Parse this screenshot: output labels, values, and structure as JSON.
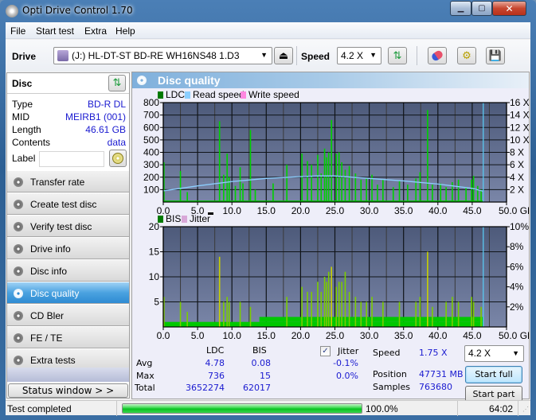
{
  "window": {
    "title": "Opti Drive Control 1.70",
    "controls": [
      "minimize",
      "maximize",
      "close"
    ]
  },
  "menu": [
    "File",
    "Start test",
    "Extra",
    "Help"
  ],
  "toolbar": {
    "drive_label": "Drive",
    "drive_value": "(J:)  HL-DT-ST BD-RE  WH16NS48 1.D3",
    "speed_label": "Speed",
    "speed_value": "4.2 X",
    "icons": [
      "eject-icon",
      "refresh-icon",
      "erase-icon",
      "settings-icon",
      "save-icon"
    ]
  },
  "disc": {
    "header": "Disc",
    "rows": [
      {
        "key": "Type",
        "value": "BD-R DL"
      },
      {
        "key": "MID",
        "value": "MEIRB1 (001)"
      },
      {
        "key": "Length",
        "value": "46.61 GB"
      },
      {
        "key": "Contents",
        "value": "data"
      }
    ],
    "label_key": "Label",
    "label_value": ""
  },
  "nav": [
    {
      "label": "Transfer rate",
      "active": false
    },
    {
      "label": "Create test disc",
      "active": false
    },
    {
      "label": "Verify test disc",
      "active": false
    },
    {
      "label": "Drive info",
      "active": false
    },
    {
      "label": "Disc info",
      "active": false
    },
    {
      "label": "Disc quality",
      "active": true
    },
    {
      "label": "CD Bler",
      "active": false
    },
    {
      "label": "FE / TE",
      "active": false
    },
    {
      "label": "Extra tests",
      "active": false
    }
  ],
  "status_window_button": "Status window > >",
  "panel_title": "Disc quality",
  "colors": {
    "ldc": "#00c000",
    "bis": "#00c000",
    "read_speed": "#8ccfff",
    "write_speed": "#ff88e0",
    "jitter": "#d8a8d8",
    "plot_bg_top": "#4d5a7a",
    "plot_bg_bottom": "#7a86a8",
    "accent": "#2f8bd3"
  },
  "chart_data": [
    {
      "type": "bar",
      "title": "LDC / Read speed",
      "legend": [
        "LDC",
        "Read speed",
        "Write speed"
      ],
      "legend_position": "top-left",
      "xlabel": "GB",
      "x_ticks": [
        "0.0",
        "5.0",
        "10.0",
        "15.0",
        "20.0",
        "25.0",
        "30.0",
        "35.0",
        "40.0",
        "45.0",
        "50.0 GB"
      ],
      "xlim": [
        0,
        50
      ],
      "y_ticks_left": [
        "100",
        "200",
        "300",
        "400",
        "500",
        "600",
        "700",
        "800"
      ],
      "ylim_left": [
        0,
        800
      ],
      "y_ticks_right": [
        "2 X",
        "4 X",
        "6 X",
        "8 X",
        "10 X",
        "12 X",
        "14 X",
        "16 X"
      ],
      "ylim_right": [
        0,
        16
      ],
      "grid": true,
      "end_marker_gb": 46.61,
      "ldc_spikes": [
        [
          0.1,
          320
        ],
        [
          2.5,
          250
        ],
        [
          3.5,
          80
        ],
        [
          8.2,
          650
        ],
        [
          8.8,
          220
        ],
        [
          9.3,
          390
        ],
        [
          9.6,
          200
        ],
        [
          10.5,
          130
        ],
        [
          11.2,
          280
        ],
        [
          11.6,
          150
        ],
        [
          12.7,
          580
        ],
        [
          13.4,
          100
        ],
        [
          16.0,
          150
        ],
        [
          18.0,
          300
        ],
        [
          20.2,
          390
        ],
        [
          21.0,
          330
        ],
        [
          21.6,
          300
        ],
        [
          22.5,
          380
        ],
        [
          23.0,
          230
        ],
        [
          23.5,
          430
        ],
        [
          23.8,
          360
        ],
        [
          24.1,
          400
        ],
        [
          24.5,
          660
        ],
        [
          25.2,
          390
        ],
        [
          25.6,
          400
        ],
        [
          26.0,
          320
        ],
        [
          26.5,
          260
        ],
        [
          27.1,
          290
        ],
        [
          28.0,
          230
        ],
        [
          28.8,
          180
        ],
        [
          29.6,
          190
        ],
        [
          30.4,
          220
        ],
        [
          31.2,
          140
        ],
        [
          32.0,
          180
        ],
        [
          33.5,
          120
        ],
        [
          34.4,
          170
        ],
        [
          35.6,
          140
        ],
        [
          36.8,
          190
        ],
        [
          37.4,
          240
        ],
        [
          38.5,
          740
        ],
        [
          39.2,
          140
        ],
        [
          40.4,
          150
        ],
        [
          41.2,
          120
        ],
        [
          42.1,
          160
        ],
        [
          43.0,
          180
        ],
        [
          44.1,
          120
        ],
        [
          44.9,
          180
        ],
        [
          45.2,
          210
        ],
        [
          45.8,
          130
        ],
        [
          46.3,
          100
        ]
      ],
      "read_speed": [
        [
          0,
          1.8
        ],
        [
          5,
          2.6
        ],
        [
          10,
          3.3
        ],
        [
          15,
          3.8
        ],
        [
          20,
          4.1
        ],
        [
          22.5,
          4.2
        ],
        [
          25,
          4.2
        ],
        [
          30,
          3.8
        ],
        [
          35,
          3.4
        ],
        [
          40,
          2.9
        ],
        [
          45,
          2.2
        ],
        [
          46.6,
          1.75
        ]
      ]
    },
    {
      "type": "bar",
      "title": "BIS / Jitter",
      "legend": [
        "BIS",
        "Jitter"
      ],
      "legend_position": "top-left",
      "xlabel": "GB",
      "x_ticks": [
        "0.0",
        "5.0",
        "10.0",
        "15.0",
        "20.0",
        "25.0",
        "30.0",
        "35.0",
        "40.0",
        "45.0",
        "50.0 GB"
      ],
      "xlim": [
        0,
        50
      ],
      "y_ticks_left": [
        "5",
        "10",
        "15",
        "20"
      ],
      "ylim_left": [
        0,
        20
      ],
      "y_ticks_right": [
        "2%",
        "4%",
        "6%",
        "8%",
        "10%"
      ],
      "ylim_right": [
        0,
        10
      ],
      "grid": true,
      "end_marker_gb": 46.61,
      "bis_spikes": [
        [
          0.1,
          6
        ],
        [
          2.5,
          5
        ],
        [
          3.5,
          3
        ],
        [
          8.2,
          14
        ],
        [
          8.8,
          5
        ],
        [
          9.3,
          6
        ],
        [
          9.6,
          5
        ],
        [
          11.2,
          5
        ],
        [
          12.7,
          4
        ],
        [
          18.0,
          6
        ],
        [
          20.2,
          8
        ],
        [
          21.0,
          7
        ],
        [
          21.6,
          7
        ],
        [
          22.5,
          9
        ],
        [
          23.0,
          7
        ],
        [
          23.5,
          10
        ],
        [
          23.8,
          9
        ],
        [
          24.1,
          11
        ],
        [
          24.5,
          12
        ],
        [
          25.2,
          8
        ],
        [
          25.6,
          9
        ],
        [
          26.0,
          9
        ],
        [
          26.5,
          11
        ],
        [
          27.1,
          7
        ],
        [
          28.0,
          6
        ],
        [
          28.8,
          5
        ],
        [
          29.6,
          5
        ],
        [
          30.4,
          6
        ],
        [
          32.0,
          5
        ],
        [
          34.4,
          5
        ],
        [
          36.8,
          5
        ],
        [
          37.4,
          6
        ],
        [
          38.5,
          15
        ],
        [
          39.2,
          4
        ],
        [
          41.2,
          5
        ],
        [
          42.1,
          6
        ],
        [
          43.0,
          5
        ],
        [
          44.9,
          6
        ],
        [
          45.2,
          5
        ],
        [
          46.3,
          4
        ]
      ]
    }
  ],
  "stats": {
    "col_ldc": "LDC",
    "col_bis": "BIS",
    "jitter_label": "Jitter",
    "jitter_checked": true,
    "rows": [
      {
        "label": "Avg",
        "ldc": "4.78",
        "bis": "0.08",
        "jitter": "-0.1%"
      },
      {
        "label": "Max",
        "ldc": "736",
        "bis": "15",
        "jitter": "0.0%"
      },
      {
        "label": "Total",
        "ldc": "3652274",
        "bis": "62017",
        "jitter": ""
      }
    ],
    "speed_label": "Speed",
    "speed_value": "1.75 X",
    "position_label": "Position",
    "position_value": "47731 MB",
    "samples_label": "Samples",
    "samples_value": "763680",
    "speed_select": "4.2 X",
    "start_full": "Start full",
    "start_part": "Start part"
  },
  "statusbar": {
    "text": "Test completed",
    "progress": 1.0,
    "progress_text": "100.0%",
    "elapsed": "64:02"
  }
}
